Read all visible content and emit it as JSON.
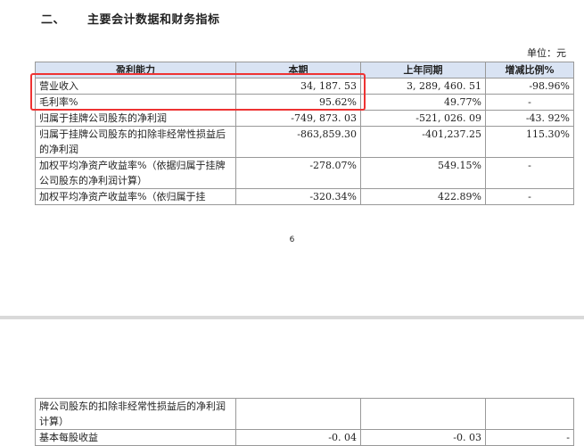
{
  "heading": {
    "number": "二、",
    "title": "主要会计数据和财务指标"
  },
  "unit": "单位：元",
  "table": {
    "headers": [
      "盈利能力",
      "本期",
      "上年同期",
      "增减比例%"
    ],
    "rows": [
      {
        "label": "营业收入",
        "current": "34, 187. 53",
        "previous": "3, 289, 460. 51",
        "change": "-98.96%"
      },
      {
        "label": "毛利率%",
        "current": "95.62%",
        "previous": "49.77%",
        "change": "-"
      },
      {
        "label": "归属于挂牌公司股东的净利润",
        "current": "-749, 873. 03",
        "previous": "-521, 026. 09",
        "change": "-43. 92%"
      },
      {
        "label": "归属于挂牌公司股东的扣除非经常性损益后的净利润",
        "current": "-863,859.30",
        "previous": "-401,237.25",
        "change": "115.30%"
      },
      {
        "label": "加权平均净资产收益率%（依据归属于挂牌公司股东的净利润计算）",
        "current": "-278.07%",
        "previous": "549.15%",
        "change": "-"
      },
      {
        "label": "加权平均净资产收益率%（依归属于挂",
        "current": "-320.34%",
        "previous": "422.89%",
        "change": "-"
      }
    ]
  },
  "page_number": "6",
  "continued": {
    "rows": [
      {
        "label": "牌公司股东的扣除非经常性损益后的净利润计算）",
        "current": "",
        "previous": "",
        "change": ""
      },
      {
        "label": "基本每股收益",
        "current": "-0. 04",
        "previous": "-0. 03",
        "change": "-"
      }
    ]
  }
}
